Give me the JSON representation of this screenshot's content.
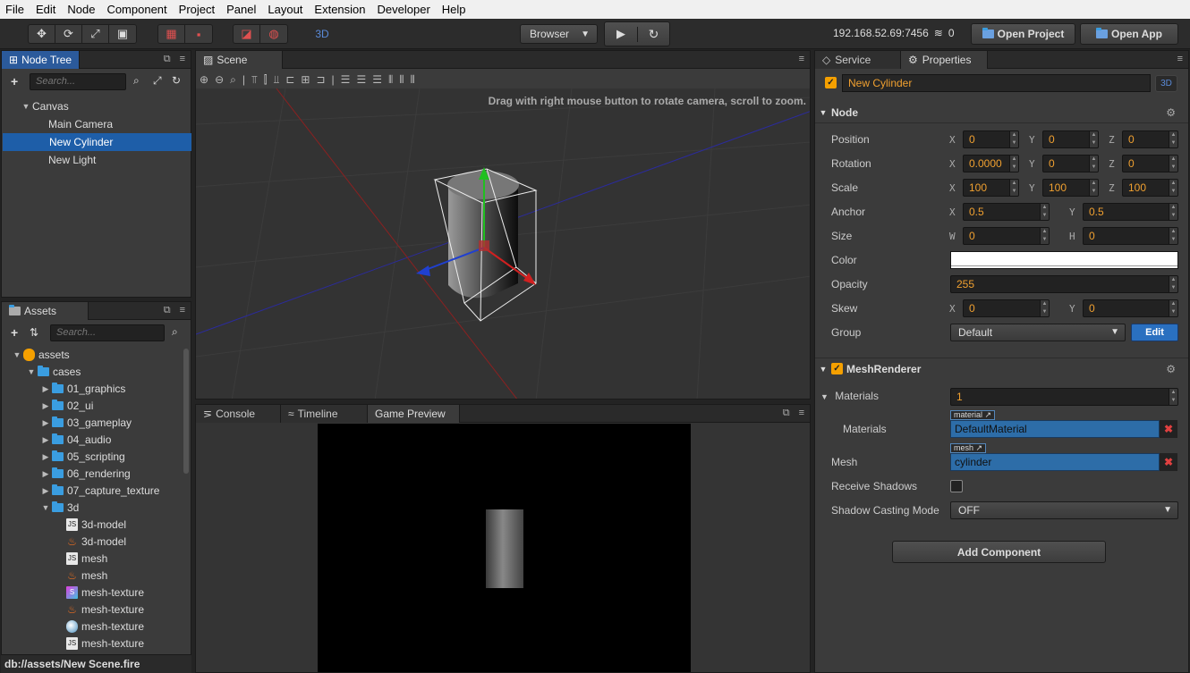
{
  "menu": [
    "File",
    "Edit",
    "Node",
    "Component",
    "Project",
    "Panel",
    "Layout",
    "Extension",
    "Developer",
    "Help"
  ],
  "toolbar": {
    "mode_3d": "3D",
    "platform": "Browser",
    "ip": "192.168.52.69:7456",
    "connections": "0",
    "open_project": "Open Project",
    "open_app": "Open App"
  },
  "node_tree": {
    "tab": "Node Tree",
    "search_placeholder": "Search...",
    "items": [
      "Canvas",
      "Main Camera",
      "New Cylinder",
      "New Light"
    ]
  },
  "assets": {
    "tab": "Assets",
    "search_placeholder": "Search...",
    "root": "assets",
    "cases": "cases",
    "folders": [
      "01_graphics",
      "02_ui",
      "03_gameplay",
      "04_audio",
      "05_scripting",
      "06_rendering",
      "07_capture_texture",
      "3d"
    ],
    "files": [
      {
        "name": "3d-model",
        "icon": "js-icon"
      },
      {
        "name": "3d-model",
        "icon": "fire-icon"
      },
      {
        "name": "mesh",
        "icon": "js-icon"
      },
      {
        "name": "mesh",
        "icon": "fire-icon"
      },
      {
        "name": "mesh-texture",
        "icon": "shader-icon"
      },
      {
        "name": "mesh-texture",
        "icon": "fire-icon"
      },
      {
        "name": "mesh-texture",
        "icon": "material-icon"
      },
      {
        "name": "mesh-texture",
        "icon": "js-icon"
      }
    ],
    "status": "db://assets/New Scene.fire"
  },
  "scene": {
    "tab": "Scene",
    "hint": "Drag with right mouse button to rotate camera, scroll to zoom."
  },
  "bottom_tabs": [
    "Console",
    "Timeline",
    "Game Preview"
  ],
  "inspector": {
    "tabs": [
      "Service",
      "Properties"
    ],
    "node_name": "New Cylinder",
    "badge_3d": "3D",
    "node_section": "Node",
    "position": {
      "label": "Position",
      "x": "0",
      "y": "0",
      "z": "0"
    },
    "rotation": {
      "label": "Rotation",
      "x": "0.0000",
      "y": "0",
      "z": "0"
    },
    "scale": {
      "label": "Scale",
      "x": "100",
      "y": "100",
      "z": "100"
    },
    "anchor": {
      "label": "Anchor",
      "x": "0.5",
      "y": "0.5"
    },
    "size": {
      "label": "Size",
      "w": "0",
      "h": "0"
    },
    "color": {
      "label": "Color",
      "value": "#ffffff"
    },
    "opacity": {
      "label": "Opacity",
      "value": "255"
    },
    "skew": {
      "label": "Skew",
      "x": "0",
      "y": "0"
    },
    "group": {
      "label": "Group",
      "value": "Default",
      "edit": "Edit"
    },
    "mesh_renderer": "MeshRenderer",
    "materials_count_label": "Materials",
    "materials_count": "1",
    "materials_label": "Materials",
    "material_tag": "material",
    "material_value": "DefaultMaterial",
    "mesh_label": "Mesh",
    "mesh_tag": "mesh",
    "mesh_value": "cylinder",
    "receive_shadows": "Receive Shadows",
    "shadow_mode_label": "Shadow Casting Mode",
    "shadow_mode_value": "OFF",
    "add_component": "Add Component"
  },
  "axis_letters": {
    "x": "X",
    "y": "Y",
    "z": "Z",
    "w": "W",
    "h": "H"
  }
}
